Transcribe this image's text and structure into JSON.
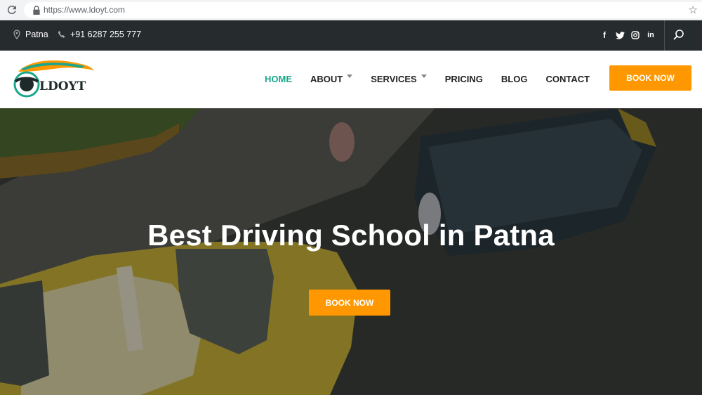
{
  "browser": {
    "url": "https://www.ldoyt.com"
  },
  "topbar": {
    "location": "Patna",
    "phone": "+91 6287 255 777",
    "social": [
      "facebook-icon",
      "twitter-icon",
      "instagram-icon",
      "linkedin-icon"
    ]
  },
  "logo": {
    "text": "LDOYT"
  },
  "nav": {
    "items": [
      {
        "label": "HOME",
        "active": true,
        "dropdown": false
      },
      {
        "label": "ABOUT",
        "active": false,
        "dropdown": true
      },
      {
        "label": "SERVICES",
        "active": false,
        "dropdown": true
      },
      {
        "label": "PRICING",
        "active": false,
        "dropdown": false
      },
      {
        "label": "BLOG",
        "active": false,
        "dropdown": false
      },
      {
        "label": "CONTACT",
        "active": false,
        "dropdown": false
      }
    ],
    "book_label": "BOOK NOW"
  },
  "hero": {
    "title": "Best Driving School in Patna",
    "button_label": "BOOK NOW"
  },
  "colors": {
    "accent": "#ff9800",
    "active_nav": "#1aa68d",
    "topbar_bg": "#262b2d"
  }
}
